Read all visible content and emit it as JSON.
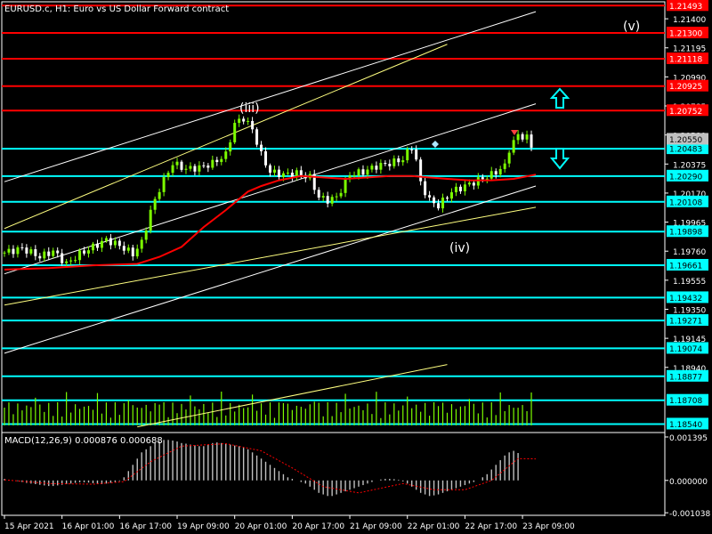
{
  "header": {
    "main_title": "EURUSD.c, H1:  Euro vs US Dollar Forward contract",
    "macd_title": "MACD(12,26,9) 0.000876 0.000688"
  },
  "colors": {
    "background": "#000000",
    "bull_candle": "#7CFC00",
    "bear_candle": "#FFFFFF",
    "moving_average": "#FF0000",
    "channel_white": "#FFFFFF",
    "channel_yellow": "#FFFF80",
    "level_red": "#FF0000",
    "level_cyan": "#00FFFF",
    "price_box": "#FF0000",
    "current_box": "#C0C0C0",
    "macd_hist": "#C0C0C0",
    "macd_signal": "#FF0000",
    "volume": "#7CFC00",
    "arrow": "#00FFFF"
  },
  "wave_labels": [
    "(iii)",
    "(iv)",
    "(v)"
  ],
  "arrows": [
    "up-arrow-icon",
    "down-arrow-icon"
  ],
  "chart_data": [
    {
      "type": "candlestick",
      "title": "EURUSD.c, H1:  Euro vs US Dollar Forward contract",
      "y_range": [
        1.1848,
        1.2152
      ],
      "y_ticks": [
        "1.21400",
        "1.21195",
        "1.20990",
        "1.20785",
        "1.20580",
        "1.20375",
        "1.20170",
        "1.19965",
        "1.19760",
        "1.19555",
        "1.19350",
        "1.19145",
        "1.18940"
      ],
      "x_ticks": [
        "15 Apr 2021",
        "16 Apr 01:00",
        "16 Apr 17:00",
        "19 Apr 09:00",
        "20 Apr 01:00",
        "20 Apr 17:00",
        "21 Apr 09:00",
        "22 Apr 01:00",
        "22 Apr 17:00",
        "23 Apr 09:00"
      ],
      "current_price": "1.20550",
      "red_levels": [
        "1.21493",
        "1.21300",
        "1.21118",
        "1.20925",
        "1.20752"
      ],
      "cyan_levels": [
        "1.20483",
        "1.20290",
        "1.20108",
        "1.19898",
        "1.19661",
        "1.19432",
        "1.19271",
        "1.19074",
        "1.18877",
        "1.18708",
        "1.18540"
      ],
      "close_path": [
        [
          0,
          1.1975
        ],
        [
          4,
          1.1978
        ],
        [
          8,
          1.1972
        ],
        [
          11,
          1.1976
        ],
        [
          14,
          1.1967
        ],
        [
          17,
          1.1974
        ],
        [
          20,
          1.1979
        ],
        [
          23,
          1.1984
        ],
        [
          26,
          1.198
        ],
        [
          29,
          1.1974
        ],
        [
          31,
          1.1982
        ],
        [
          33,
          1.2004
        ],
        [
          35,
          1.202
        ],
        [
          38,
          1.2038
        ],
        [
          41,
          1.2034
        ],
        [
          44,
          1.2035
        ],
        [
          47,
          1.2038
        ],
        [
          50,
          1.2044
        ],
        [
          52,
          1.2066
        ],
        [
          54,
          1.207
        ],
        [
          56,
          1.2062
        ],
        [
          58,
          1.2044
        ],
        [
          60,
          1.2032
        ],
        [
          63,
          1.203
        ],
        [
          66,
          1.2031
        ],
        [
          69,
          1.2028
        ],
        [
          71,
          1.2014
        ],
        [
          73,
          1.2012
        ],
        [
          75,
          1.2014
        ],
        [
          78,
          1.203
        ],
        [
          81,
          1.2032
        ],
        [
          84,
          1.2036
        ],
        [
          87,
          1.2038
        ],
        [
          90,
          1.2041
        ],
        [
          92,
          1.205
        ],
        [
          93,
          1.204
        ],
        [
          94,
          1.2024
        ],
        [
          96,
          1.2012
        ],
        [
          98,
          1.2008
        ],
        [
          101,
          1.2018
        ],
        [
          104,
          1.2022
        ],
        [
          107,
          1.2026
        ],
        [
          110,
          1.203
        ],
        [
          113,
          1.2036
        ],
        [
          114,
          1.2048
        ],
        [
          116,
          1.2058
        ],
        [
          118,
          1.2056
        ],
        [
          119,
          1.205
        ]
      ],
      "ma_path": [
        [
          0,
          1.1963
        ],
        [
          10,
          1.1964
        ],
        [
          20,
          1.1966
        ],
        [
          30,
          1.1967
        ],
        [
          35,
          1.1972
        ],
        [
          40,
          1.1979
        ],
        [
          45,
          1.1993
        ],
        [
          50,
          1.2005
        ],
        [
          55,
          1.2018
        ],
        [
          58,
          1.2022
        ],
        [
          62,
          1.2026
        ],
        [
          67,
          1.2029
        ],
        [
          72,
          1.2028
        ],
        [
          77,
          1.2027
        ],
        [
          82,
          1.2028
        ],
        [
          87,
          1.2029
        ],
        [
          92,
          1.2029
        ],
        [
          96,
          1.2028
        ],
        [
          100,
          1.2027
        ],
        [
          105,
          1.2026
        ],
        [
          110,
          1.2026
        ],
        [
          115,
          1.2027
        ],
        [
          120,
          1.203
        ]
      ],
      "white_lines": [
        [
          [
            0,
            1.2025
          ],
          [
            120,
            1.2145
          ]
        ],
        [
          [
            0,
            1.196
          ],
          [
            120,
            1.208
          ]
        ],
        [
          [
            0,
            1.1904
          ],
          [
            120,
            1.2022
          ]
        ]
      ],
      "yellow_lines": [
        [
          [
            0,
            1.1992
          ],
          [
            100,
            1.2122
          ]
        ],
        [
          [
            0,
            1.1938
          ],
          [
            120,
            1.2007
          ]
        ],
        [
          [
            30,
            1.1852
          ],
          [
            100,
            1.1896
          ]
        ]
      ]
    },
    {
      "type": "histogram",
      "title": "MACD(12,26,9) 0.000876 0.000688",
      "y_ticks": [
        "0.001395",
        "0.000000",
        "-0.001038"
      ],
      "y_range": [
        -0.00112,
        0.00148
      ],
      "histogram": [
        5e-05,
        2e-05,
        0.0,
        -2e-05,
        -5e-05,
        -8e-05,
        -0.0001,
        -0.00012,
        -0.00014,
        -0.00016,
        -0.00018,
        -0.00018,
        -0.00016,
        -0.00014,
        -0.00012,
        -0.0001,
        -8e-05,
        -6e-05,
        -6e-05,
        -7e-05,
        -9e-05,
        -0.00011,
        -0.00012,
        -0.0001,
        -8e-05,
        -5e-05,
        -2e-05,
        0.0001,
        0.0003,
        0.0005,
        0.0007,
        0.0009,
        0.001,
        0.0011,
        0.0012,
        0.00125,
        0.0013,
        0.0013,
        0.00128,
        0.00125,
        0.0012,
        0.00118,
        0.00115,
        0.00113,
        0.0011,
        0.0011,
        0.00115,
        0.0012,
        0.00122,
        0.0012,
        0.00118,
        0.00115,
        0.00112,
        0.0011,
        0.00105,
        0.001,
        0.0009,
        0.0008,
        0.0007,
        0.0006,
        0.0005,
        0.0004,
        0.0003,
        0.0002,
        0.0001,
        5e-05,
        0.0,
        -5e-05,
        -0.0001,
        -0.0002,
        -0.0003,
        -0.0004,
        -0.00045,
        -0.0005,
        -0.0005,
        -0.00045,
        -0.0004,
        -0.00035,
        -0.0003,
        -0.00025,
        -0.0002,
        -0.00015,
        -0.0001,
        -5e-05,
        0.0,
        3e-05,
        5e-05,
        5e-05,
        4e-05,
        2e-05,
        -3e-05,
        -0.0001,
        -0.0002,
        -0.0003,
        -0.0004,
        -0.00045,
        -0.0005,
        -0.00048,
        -0.00045,
        -0.0004,
        -0.00035,
        -0.0003,
        -0.00025,
        -0.0002,
        -0.00015,
        -0.0001,
        -5e-05,
        0.0,
        0.0001,
        0.0002,
        0.00035,
        0.0005,
        0.00065,
        0.0008,
        0.0009,
        0.00095,
        0.00088
      ],
      "signal": [
        [
          0,
          2e-05
        ],
        [
          10,
          -0.0001
        ],
        [
          20,
          -0.00012
        ],
        [
          27,
          -4e-05
        ],
        [
          33,
          0.0006
        ],
        [
          40,
          0.0011
        ],
        [
          50,
          0.00118
        ],
        [
          58,
          0.00095
        ],
        [
          65,
          0.0004
        ],
        [
          72,
          -0.0002
        ],
        [
          80,
          -0.0004
        ],
        [
          90,
          -0.0001
        ],
        [
          97,
          -0.0003
        ],
        [
          104,
          -0.0003
        ],
        [
          110,
          0.0
        ],
        [
          116,
          0.0007
        ],
        [
          120,
          0.00069
        ]
      ]
    }
  ]
}
